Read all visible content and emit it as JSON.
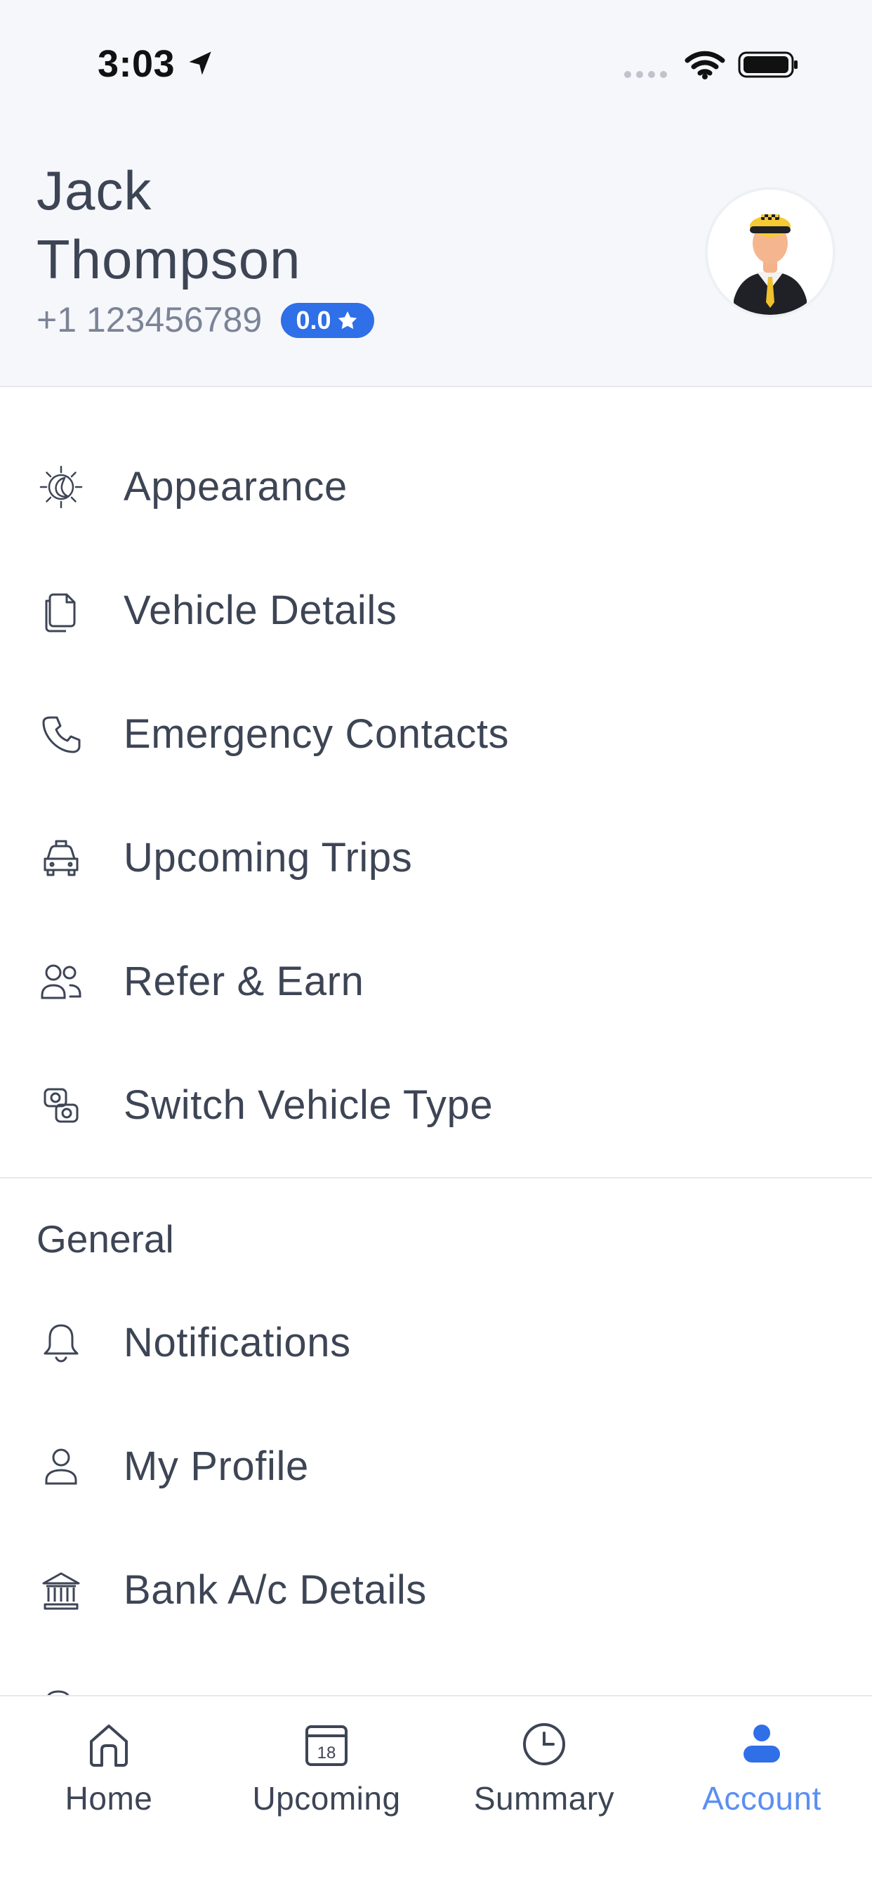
{
  "status_bar": {
    "time": "3:03"
  },
  "profile": {
    "first_name": "Jack",
    "last_name": "Thompson",
    "phone": "+1 123456789",
    "rating": "0.0"
  },
  "menu": {
    "items": [
      {
        "label": "Appearance",
        "icon": "theme-icon"
      },
      {
        "label": "Vehicle Details",
        "icon": "document-icon"
      },
      {
        "label": "Emergency Contacts",
        "icon": "phone-icon"
      },
      {
        "label": "Upcoming Trips",
        "icon": "taxi-icon"
      },
      {
        "label": "Refer & Earn",
        "icon": "users-icon"
      },
      {
        "label": "Switch Vehicle Type",
        "icon": "switch-icon"
      }
    ]
  },
  "general": {
    "title": "General",
    "items": [
      {
        "label": "Notifications",
        "icon": "bell-icon"
      },
      {
        "label": "My Profile",
        "icon": "user-icon"
      },
      {
        "label": "Bank A/c Details",
        "icon": "bank-icon"
      }
    ]
  },
  "bottom_nav": {
    "items": [
      {
        "label": "Home",
        "icon": "home-icon"
      },
      {
        "label": "Upcoming",
        "icon": "calendar-icon",
        "date": "18"
      },
      {
        "label": "Summary",
        "icon": "clock-icon"
      },
      {
        "label": "Account",
        "icon": "account-icon"
      }
    ],
    "active": "Account"
  },
  "colors": {
    "accent": "#2f6fe7",
    "active_tab": "#5b8ff0",
    "text": "#3d4555",
    "muted_text": "#7b8496",
    "header_bg": "#f6f7fb"
  }
}
